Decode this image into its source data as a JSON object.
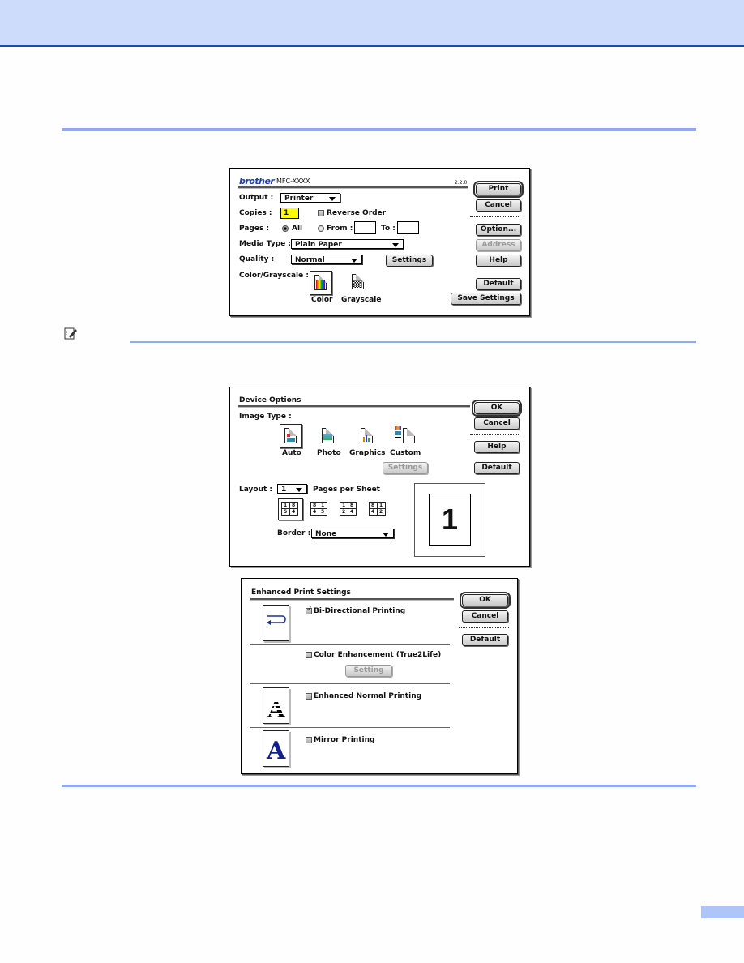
{
  "page": {
    "header_color": "#cddcfb",
    "header_line_color": "#1a4db3",
    "rule_color": "#8eabf0",
    "note_icon": "pencil-note-icon"
  },
  "print_dialog": {
    "brand": "brother",
    "model": "MFC-XXXX",
    "version": "2.2.0",
    "output_label": "Output :",
    "output_value": "Printer",
    "copies_label": "Copies :",
    "copies_value": "1",
    "reverse_order_label": "Reverse Order",
    "reverse_order_checked": false,
    "pages_label": "Pages :",
    "pages_all_label": "All",
    "pages_from_label": "From :",
    "pages_to_label": "To :",
    "pages_from_value": "",
    "pages_to_value": "",
    "media_type_label": "Media Type :",
    "media_type_value": "Plain Paper",
    "quality_label": "Quality :",
    "quality_value": "Normal",
    "settings_button": "Settings",
    "color_grayscale_label": "Color/Grayscale :",
    "color_option": "Color",
    "grayscale_option": "Grayscale",
    "buttons": {
      "print": "Print",
      "cancel": "Cancel",
      "option": "Option...",
      "address": "Address",
      "help": "Help",
      "default": "Default",
      "save_settings": "Save Settings"
    }
  },
  "device_options": {
    "title": "Device Options",
    "image_type_label": "Image Type :",
    "image_types": [
      "Auto",
      "Photo",
      "Graphics",
      "Custom"
    ],
    "selected_image_type": "Auto",
    "settings_button": "Settings",
    "layout_label": "Layout :",
    "layout_value": "1",
    "pages_per_sheet_label": "Pages per Sheet",
    "layout_orders": [
      [
        "1",
        "8",
        "5",
        "4"
      ],
      [
        "8",
        "1",
        "4",
        "5"
      ],
      [
        "1",
        "8",
        "2",
        "4"
      ],
      [
        "8",
        "1",
        "4",
        "2"
      ]
    ],
    "border_label": "Border :",
    "border_value": "None",
    "preview_number": "1",
    "buttons": {
      "ok": "OK",
      "cancel": "Cancel",
      "help": "Help",
      "default": "Default"
    }
  },
  "enhanced_print": {
    "title": "Enhanced Print Settings",
    "options": [
      {
        "label": "Bi-Directional Printing",
        "checked": true
      },
      {
        "label": "Color Enhancement (True2Life)",
        "checked": false
      },
      {
        "label": "Enhanced Normal Printing",
        "checked": false
      },
      {
        "label": "Mirror Printing",
        "checked": false
      }
    ],
    "setting_button": "Setting",
    "buttons": {
      "ok": "OK",
      "cancel": "Cancel",
      "default": "Default"
    }
  }
}
